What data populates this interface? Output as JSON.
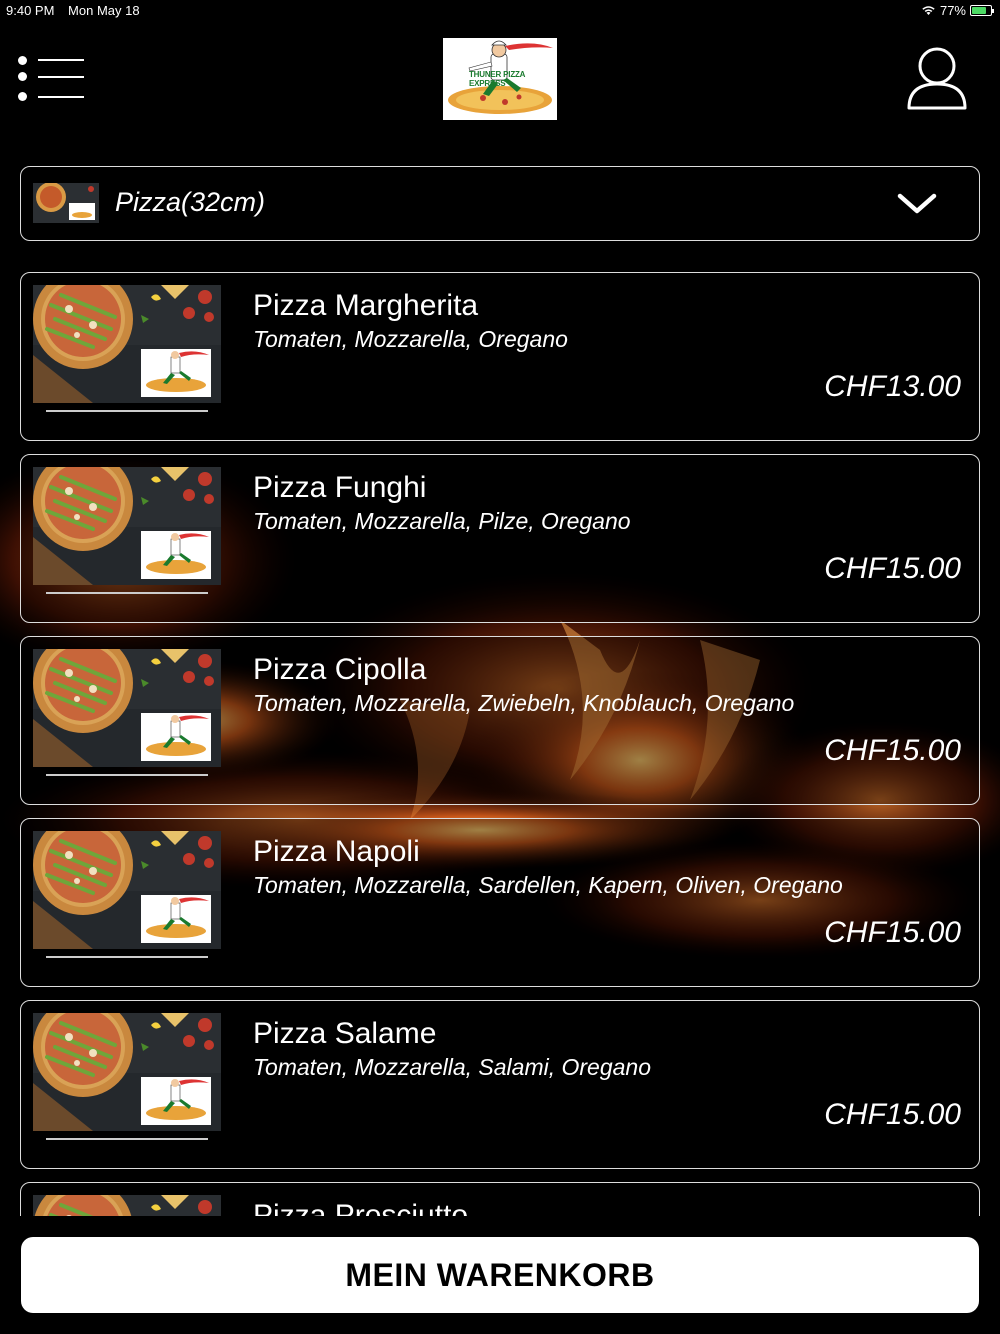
{
  "status_bar": {
    "time": "9:40 PM",
    "date": "Mon May 18",
    "battery": "77%",
    "battery_level": 0.77
  },
  "header": {
    "logo_text": "THUNER PIZZA EXPRESS"
  },
  "category": {
    "selected": "Pizza(32cm)"
  },
  "items": [
    {
      "name": "Pizza Margherita",
      "description": "Tomaten, Mozzarella, Oregano",
      "price": "CHF13.00"
    },
    {
      "name": "Pizza Funghi",
      "description": "Tomaten, Mozzarella, Pilze, Oregano",
      "price": "CHF15.00"
    },
    {
      "name": "Pizza Cipolla",
      "description": "Tomaten, Mozzarella, Zwiebeln, Knoblauch, Oregano",
      "price": "CHF15.00"
    },
    {
      "name": "Pizza Napoli",
      "description": "Tomaten, Mozzarella, Sardellen, Kapern, Oliven, Oregano",
      "price": "CHF15.00"
    },
    {
      "name": "Pizza Salame",
      "description": "Tomaten, Mozzarella, Salami, Oregano",
      "price": "CHF15.00"
    },
    {
      "name": "Pizza Prosciutto",
      "description": "",
      "price": ""
    }
  ],
  "cart": {
    "label": "MEIN WARENKORB"
  },
  "colors": {
    "background": "#000000",
    "border": "#dddddd",
    "button_bg": "#ffffff",
    "battery_fill": "#4cd964"
  },
  "icons": {
    "menu": "list-menu-icon",
    "account": "user-icon",
    "dropdown": "chevron-down-icon",
    "wifi": "wifi-icon"
  }
}
